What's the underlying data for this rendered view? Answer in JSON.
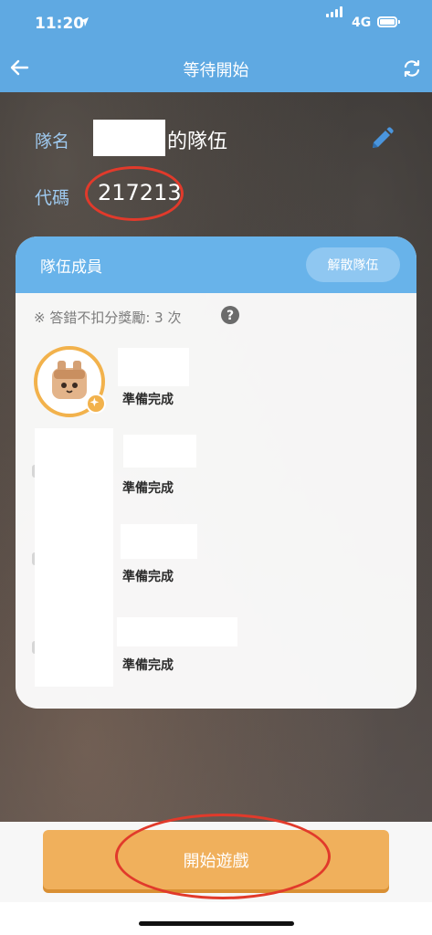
{
  "status_bar": {
    "time": "11:20",
    "network": "4G"
  },
  "nav": {
    "title": "等待開始",
    "back_icon": "arrow-left-icon",
    "refresh_icon": "refresh-icon"
  },
  "team": {
    "name_label": "隊名",
    "name_suffix": "的隊伍",
    "code_label": "代碼",
    "code": "217213",
    "edit_icon": "pencil-icon"
  },
  "members_card": {
    "title": "隊伍成員",
    "disband_label": "解散隊伍",
    "bonus_text": "※ 答錯不扣分獎勵: 3 次",
    "help_icon": "question-circle-icon",
    "members": [
      {
        "status": "準備完成"
      },
      {
        "status": "準備完成"
      },
      {
        "status": "準備完成"
      },
      {
        "status": "準備完成"
      }
    ]
  },
  "footer": {
    "start_label": "開始遊戲"
  },
  "colors": {
    "header_blue": "#5fa9e2",
    "card_header_blue": "#68b3ea",
    "start_orange": "#f0b05c",
    "annotation_red": "#e13a2b"
  }
}
